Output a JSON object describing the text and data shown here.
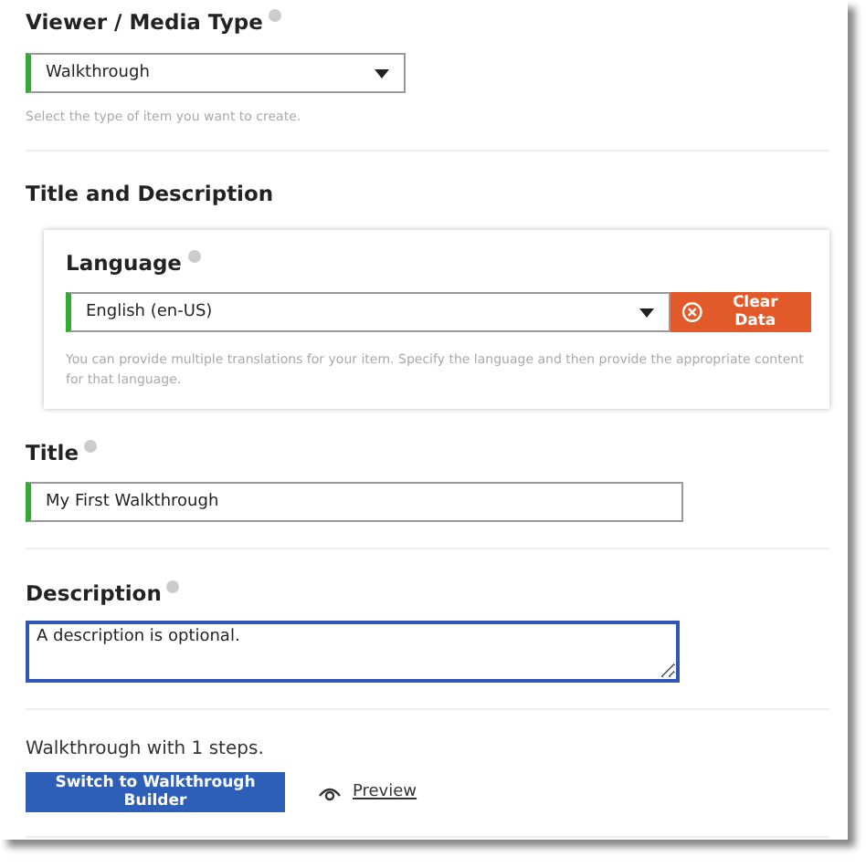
{
  "media_type": {
    "label": "Viewer / Media Type",
    "value": "Walkthrough",
    "hint": "Select the type of item you want to create."
  },
  "section_title": "Title and Description",
  "language": {
    "label": "Language",
    "value": "English (en-US)",
    "clear_button": "Clear Data",
    "hint": "You can provide multiple translations for your item. Specify the language and then provide the appropriate content for that language."
  },
  "title": {
    "label": "Title",
    "value": "My First Walkthrough"
  },
  "description": {
    "label": "Description",
    "value": "A description is optional.",
    "focused": true
  },
  "steps_text": "Walkthrough with 1 steps.",
  "builder_button": "Switch to Walkthrough Builder",
  "preview_link": "Preview"
}
